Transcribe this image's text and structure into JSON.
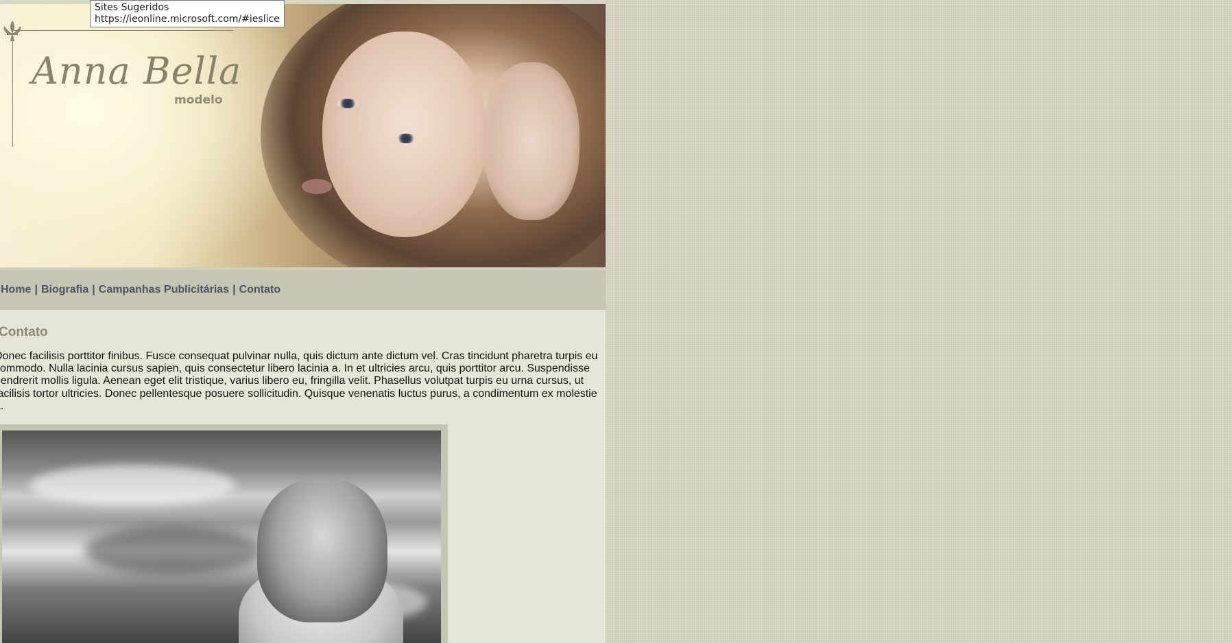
{
  "tooltip": {
    "line1": "Sites Sugeridos",
    "line2": "https://ieonline.microsoft.com/#ieslice"
  },
  "header": {
    "logo_title": "Anna Bella",
    "logo_subtitle": "modelo",
    "ornament_icon": "fleur-de-lis-icon"
  },
  "nav": {
    "items": [
      {
        "label": "Home"
      },
      {
        "label": "Biografia"
      },
      {
        "label": "Campanhas Publicitárias"
      },
      {
        "label": "Contato"
      }
    ],
    "separator": "|"
  },
  "content": {
    "title": "Contato",
    "paragraph": "Donec facilisis porttitor finibus. Fusce consequat pulvinar nulla, quis dictum ante dictum vel. Cras tincidunt pharetra turpis eu commodo. Nulla lacinia cursus sapien, quis consectetur libero lacinia a. In et ultricies arcu, quis porttitor arcu. Suspendisse hendrerit mollis ligula. Aenean eget elit tristique, varius libero eu, fringilla velit. Phasellus volutpat turpis eu urna cursus, ut facilisis tortor ultricies. Donec pellentesque posuere sollicitudin. Quisque venenatis luctus purus, a condimentum ex molestie a."
  },
  "colors": {
    "page_bg": "#d6d7c4",
    "content_bg": "#e6e6d7",
    "nav_bg": "#c6c6b2",
    "nav_text": "#4a5462",
    "title_text": "#8a8874"
  }
}
